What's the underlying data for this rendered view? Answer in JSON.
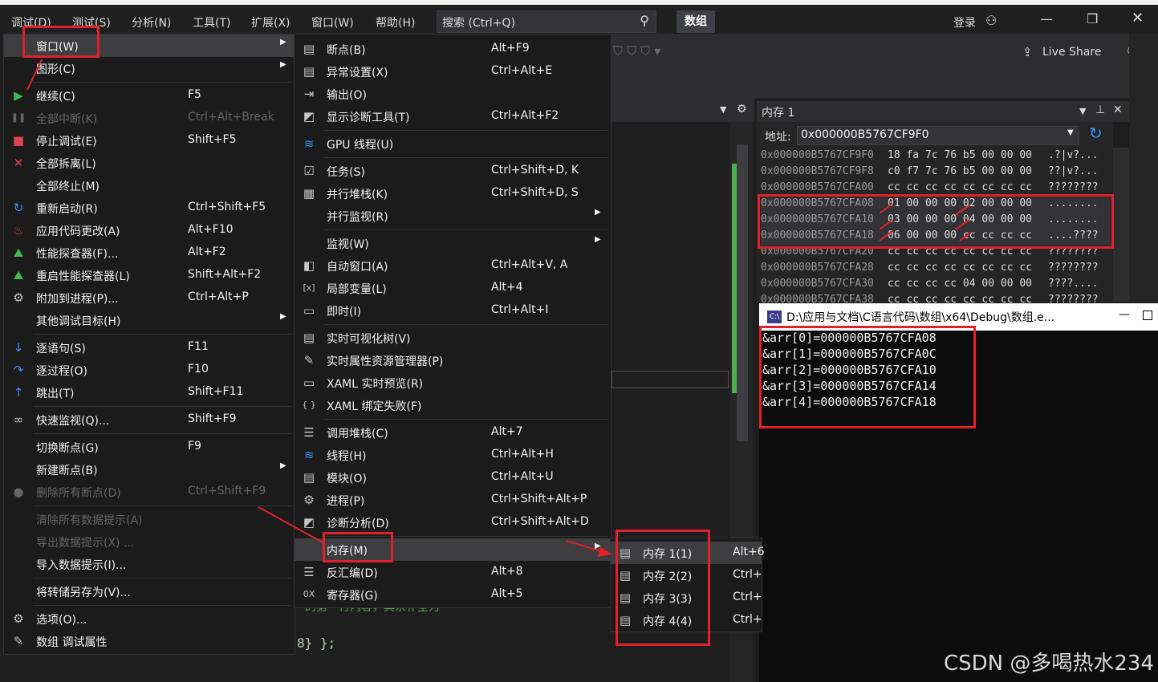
{
  "menubar": {
    "items": [
      "调试(D)",
      "测试(S)",
      "分析(N)",
      "工具(T)",
      "扩展(X)",
      "窗口(W)",
      "帮助(H)"
    ],
    "search_placeholder": "搜索 (Ctrl+Q)",
    "solution_name": "数组",
    "login": "登录",
    "live_share": "Live Share"
  },
  "debug_menu": {
    "items": [
      {
        "label": "窗口(W)",
        "shortcut": "",
        "submenu": true,
        "icon": "",
        "disabled": false
      },
      {
        "label": "图形(C)",
        "shortcut": "",
        "submenu": true,
        "icon": "",
        "disabled": false
      },
      {
        "label": "继续(C)",
        "shortcut": "F5",
        "icon": "play-icon",
        "disabled": false
      },
      {
        "label": "全部中断(K)",
        "shortcut": "Ctrl+Alt+Break",
        "icon": "pause-icon",
        "disabled": true
      },
      {
        "label": "停止调试(E)",
        "shortcut": "Shift+F5",
        "icon": "stop-icon",
        "disabled": false
      },
      {
        "label": "全部拆离(L)",
        "shortcut": "",
        "icon": "detach-icon",
        "disabled": false
      },
      {
        "label": "全部终止(M)",
        "shortcut": "",
        "icon": "",
        "disabled": false
      },
      {
        "label": "重新启动(R)",
        "shortcut": "Ctrl+Shift+F5",
        "icon": "restart-icon",
        "disabled": false
      },
      {
        "label": "应用代码更改(A)",
        "shortcut": "Alt+F10",
        "icon": "hot-reload-icon",
        "disabled": false
      },
      {
        "label": "性能探查器(F)...",
        "shortcut": "Alt+F2",
        "icon": "profiler-icon",
        "disabled": false
      },
      {
        "label": "重启性能探查器(L)",
        "shortcut": "Shift+Alt+F2",
        "icon": "profiler-restart-icon",
        "disabled": false
      },
      {
        "label": "附加到进程(P)...",
        "shortcut": "Ctrl+Alt+P",
        "icon": "attach-icon",
        "disabled": false
      },
      {
        "label": "其他调试目标(H)",
        "shortcut": "",
        "submenu": true,
        "icon": "",
        "disabled": false
      },
      {
        "label": "逐语句(S)",
        "shortcut": "F11",
        "icon": "step-into-icon",
        "disabled": false
      },
      {
        "label": "逐过程(O)",
        "shortcut": "F10",
        "icon": "step-over-icon",
        "disabled": false
      },
      {
        "label": "跳出(T)",
        "shortcut": "Shift+F11",
        "icon": "step-out-icon",
        "disabled": false
      },
      {
        "label": "快速监视(Q)...",
        "shortcut": "Shift+F9",
        "icon": "glasses-icon",
        "disabled": false
      },
      {
        "label": "切换断点(G)",
        "shortcut": "F9",
        "icon": "",
        "disabled": false
      },
      {
        "label": "新建断点(B)",
        "shortcut": "",
        "submenu": true,
        "icon": "",
        "disabled": false
      },
      {
        "label": "删除所有断点(D)",
        "shortcut": "Ctrl+Shift+F9",
        "icon": "breakpoints-icon",
        "disabled": true
      },
      {
        "label": "清除所有数据提示(A)",
        "shortcut": "",
        "icon": "",
        "disabled": true
      },
      {
        "label": "导出数据提示(X) ...",
        "shortcut": "",
        "icon": "",
        "disabled": true
      },
      {
        "label": "导入数据提示(I)...",
        "shortcut": "",
        "icon": "",
        "disabled": false
      },
      {
        "label": "将转储另存为(V)...",
        "shortcut": "",
        "icon": "",
        "disabled": false
      },
      {
        "label": "选项(O)...",
        "shortcut": "",
        "icon": "gear-icon",
        "disabled": false
      },
      {
        "label": "数组 调试属性",
        "shortcut": "",
        "icon": "wrench-icon",
        "disabled": false
      }
    ]
  },
  "window_menu": {
    "items": [
      {
        "label": "断点(B)",
        "shortcut": "Alt+F9",
        "icon": "breakpoints-window-icon"
      },
      {
        "label": "异常设置(X)",
        "shortcut": "Ctrl+Alt+E",
        "icon": "exception-icon"
      },
      {
        "label": "输出(O)",
        "shortcut": "",
        "icon": "output-icon"
      },
      {
        "label": "显示诊断工具(T)",
        "shortcut": "Ctrl+Alt+F2",
        "icon": "diagnostics-icon"
      },
      {
        "label": "GPU 线程(U)",
        "shortcut": "",
        "icon": "gpu-thread-icon"
      },
      {
        "label": "任务(S)",
        "shortcut": "Ctrl+Shift+D, K",
        "icon": "tasks-icon"
      },
      {
        "label": "并行堆栈(K)",
        "shortcut": "Ctrl+Shift+D, S",
        "icon": "parallel-stacks-icon"
      },
      {
        "label": "并行监视(R)",
        "shortcut": "",
        "submenu": true,
        "icon": ""
      },
      {
        "label": "监视(W)",
        "shortcut": "",
        "submenu": true,
        "icon": ""
      },
      {
        "label": "自动窗口(A)",
        "shortcut": "Ctrl+Alt+V, A",
        "icon": "autos-icon"
      },
      {
        "label": "局部变量(L)",
        "shortcut": "Alt+4",
        "icon": "locals-icon"
      },
      {
        "label": "即时(I)",
        "shortcut": "Ctrl+Alt+I",
        "icon": "immediate-icon"
      },
      {
        "label": "实时可视化树(V)",
        "shortcut": "",
        "icon": "visual-tree-icon"
      },
      {
        "label": "实时属性资源管理器(P)",
        "shortcut": "",
        "icon": "property-explorer-icon"
      },
      {
        "label": "XAML 实时预览(R)",
        "shortcut": "",
        "icon": "xaml-preview-icon"
      },
      {
        "label": "XAML 绑定失败(F)",
        "shortcut": "",
        "icon": "xaml-binding-icon"
      },
      {
        "label": "调用堆栈(C)",
        "shortcut": "Alt+7",
        "icon": "call-stack-icon"
      },
      {
        "label": "线程(H)",
        "shortcut": "Ctrl+Alt+H",
        "icon": "threads-icon"
      },
      {
        "label": "模块(O)",
        "shortcut": "Ctrl+Alt+U",
        "icon": "modules-icon"
      },
      {
        "label": "进程(P)",
        "shortcut": "Ctrl+Shift+Alt+P",
        "icon": "processes-icon"
      },
      {
        "label": "诊断分析(D)",
        "shortcut": "Ctrl+Shift+Alt+D",
        "icon": "diagnostic-analysis-icon"
      },
      {
        "label": "内存(M)",
        "shortcut": "",
        "submenu": true,
        "icon": ""
      },
      {
        "label": "反汇编(D)",
        "shortcut": "Alt+8",
        "icon": "disassembly-icon"
      },
      {
        "label": "寄存器(G)",
        "shortcut": "Alt+5",
        "icon": "registers-icon"
      }
    ]
  },
  "memory_submenu": {
    "items": [
      {
        "label": "内存 1(1)",
        "shortcut": "Alt+6"
      },
      {
        "label": "内存 2(2)",
        "shortcut": "Ctrl+"
      },
      {
        "label": "内存 3(3)",
        "shortcut": "Ctrl+"
      },
      {
        "label": "内存 4(4)",
        "shortcut": "Ctrl+"
      }
    ]
  },
  "memory_window": {
    "title": "内存 1",
    "address_label": "地址:",
    "address_value": "0x000000B5767CF9F0",
    "rows": [
      {
        "addr": "0x000000B5767CF9F0",
        "bytes": "18 fa 7c 76 b5 00 00 00",
        "ascii": ".?|v?..."
      },
      {
        "addr": "0x000000B5767CF9F8",
        "bytes": "c0 f7 7c 76 b5 00 00 00",
        "ascii": "??|v?..."
      },
      {
        "addr": "0x000000B5767CFA00",
        "bytes": "cc cc cc cc cc cc cc cc",
        "ascii": "????????"
      },
      {
        "addr": "0x000000B5767CFA08",
        "bytes": "01 00 00 00 02 00 00 00",
        "ascii": "........"
      },
      {
        "addr": "0x000000B5767CFA10",
        "bytes": "03 00 00 00 04 00 00 00",
        "ascii": "........"
      },
      {
        "addr": "0x000000B5767CFA18",
        "bytes": "06 00 00 00 cc cc cc cc",
        "ascii": "....????"
      },
      {
        "addr": "0x000000B5767CFA20",
        "bytes": "cc cc cc cc cc cc cc cc",
        "ascii": "????????"
      },
      {
        "addr": "0x000000B5767CFA28",
        "bytes": "cc cc cc cc cc cc cc cc",
        "ascii": "????????"
      },
      {
        "addr": "0x000000B5767CFA30",
        "bytes": "cc cc cc cc 04 00 00 00",
        "ascii": "????...."
      },
      {
        "addr": "0x000000B5767CFA38",
        "bytes": "cc cc cc cc cc cc cc cc",
        "ascii": "????????"
      }
    ]
  },
  "console": {
    "title": "D:\\应用与文档\\C语言代码\\数组\\x64\\Debug\\数组.e...",
    "lines": [
      "&arr[0]=000000B5767CFA08",
      "&arr[1]=000000B5767CFA0C",
      "&arr[2]=000000B5767CFA10",
      "&arr[3]=000000B5767CFA14",
      "&arr[4]=000000B5767CFA18"
    ]
  },
  "editor": {
    "fragment1": "8} };",
    "fragment2": "的第一行内容，其余补全为"
  },
  "watermark": "CSDN @多喝热水234",
  "colors": {
    "annotation_red": "#e0202a",
    "menu_bg": "#1b1b1c",
    "highlight": "#3e3e40",
    "console_bg": "#0c0c0c"
  }
}
